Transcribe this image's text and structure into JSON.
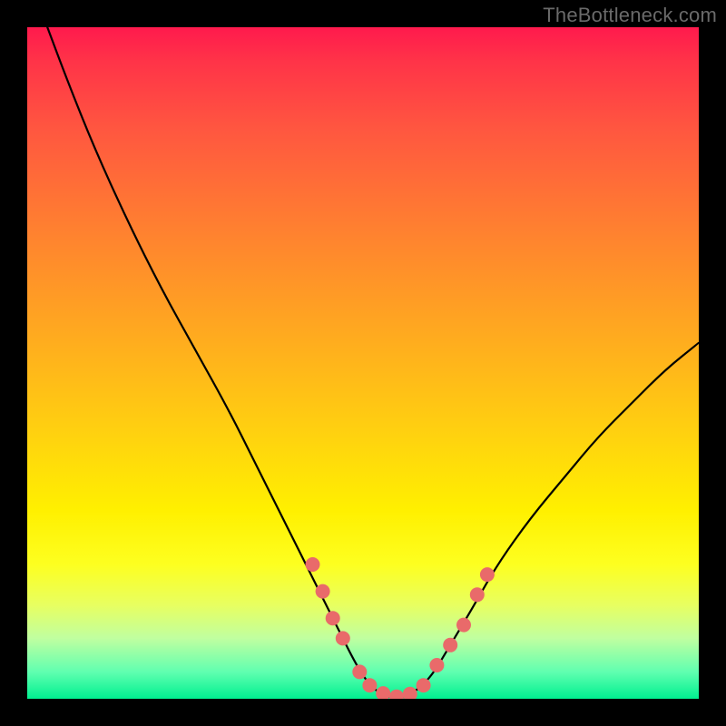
{
  "watermark": "TheBottleneck.com",
  "colors": {
    "frame_bg": "#000000",
    "curve": "#000000",
    "marker": "#e96a6a",
    "gradient_top": "#ff1a4d",
    "gradient_bottom": "#00f090"
  },
  "chart_data": {
    "type": "line",
    "title": "",
    "xlabel": "",
    "ylabel": "",
    "xlim": [
      0,
      100
    ],
    "ylim": [
      0,
      100
    ],
    "x": [
      3,
      6,
      10,
      15,
      20,
      25,
      30,
      34,
      38,
      42,
      46,
      49,
      51,
      53,
      55,
      57,
      60,
      63,
      66,
      70,
      75,
      80,
      85,
      90,
      95,
      100
    ],
    "y": [
      100,
      92,
      82,
      71,
      61,
      52,
      43,
      35,
      27,
      19,
      11,
      5,
      2,
      0.5,
      0,
      0.5,
      3,
      8,
      13,
      20,
      27,
      33,
      39,
      44,
      49,
      53
    ],
    "series": [
      {
        "name": "markers",
        "x": [
          42.5,
          44,
          45.5,
          47,
          49.5,
          51,
          53,
          55,
          57,
          59,
          61,
          63,
          65,
          67,
          68.5
        ],
        "y": [
          20,
          16,
          12,
          9,
          4,
          2,
          0.8,
          0.3,
          0.7,
          2,
          5,
          8,
          11,
          15.5,
          18.5
        ]
      }
    ]
  }
}
